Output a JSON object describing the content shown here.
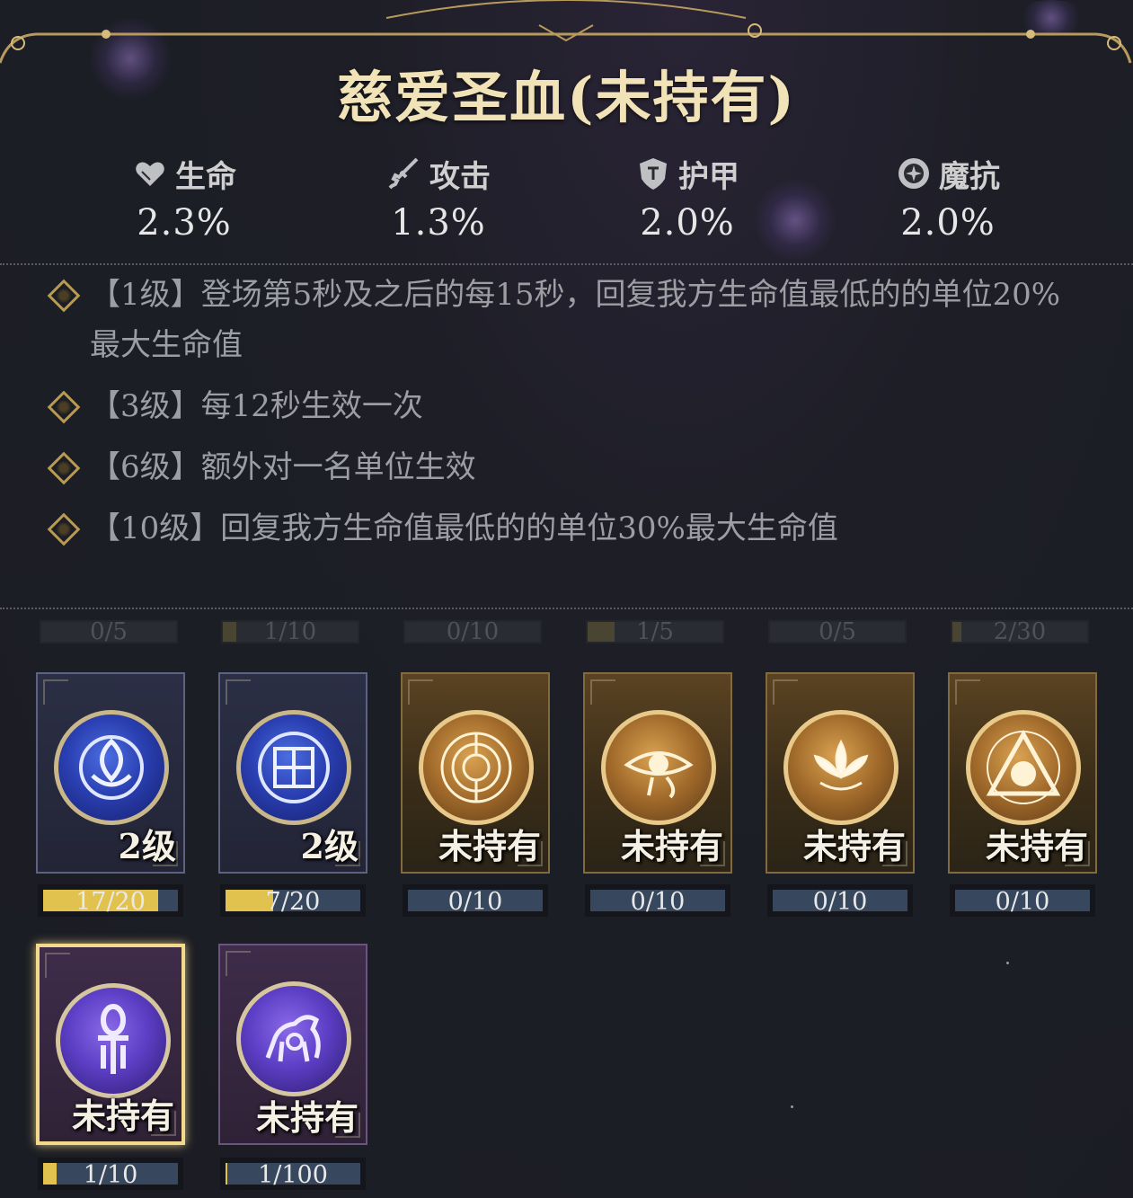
{
  "title": "慈爱圣血(未持有)",
  "stats": [
    {
      "icon": "heart-icon",
      "label": "生命",
      "value": "2.3%"
    },
    {
      "icon": "sword-icon",
      "label": "攻击",
      "value": "1.3%"
    },
    {
      "icon": "shield-icon",
      "label": "护甲",
      "value": "2.0%"
    },
    {
      "icon": "magic-orb-icon",
      "label": "魔抗",
      "value": "2.0%"
    }
  ],
  "effects": [
    {
      "text": "【1级】登场第5秒及之后的每15秒，回复我方生命值最低的的单位20%最大生命值"
    },
    {
      "text": "【3级】每12秒生效一次"
    },
    {
      "text": "【6级】额外对一名单位生效"
    },
    {
      "text": "【10级】回复我方生命值最低的的单位30%最大生命值"
    }
  ],
  "top_tracks": [
    {
      "text": "0/5",
      "fill": 0
    },
    {
      "text": "1/10",
      "fill": 0.1
    },
    {
      "text": "0/10",
      "fill": 0
    },
    {
      "text": "1/5",
      "fill": 0.2
    },
    {
      "text": "0/5",
      "fill": 0
    },
    {
      "text": "2/30",
      "fill": 0.067
    }
  ],
  "cards": [
    {
      "label": "2级",
      "progress": "17/20",
      "fill": 0.85,
      "theme": "blue",
      "emblem": "triquetra-moon-emblem"
    },
    {
      "label": "2级",
      "progress": "7/20",
      "fill": 0.35,
      "theme": "blue",
      "emblem": "longevity-symbol-emblem"
    },
    {
      "label": "未持有",
      "progress": "0/10",
      "fill": 0,
      "theme": "gold",
      "emblem": "maze-wheel-emblem"
    },
    {
      "label": "未持有",
      "progress": "0/10",
      "fill": 0,
      "theme": "gold",
      "emblem": "eye-of-horus-emblem"
    },
    {
      "label": "未持有",
      "progress": "0/10",
      "fill": 0,
      "theme": "gold",
      "emblem": "lotus-emblem"
    },
    {
      "label": "未持有",
      "progress": "0/10",
      "fill": 0,
      "theme": "gold",
      "emblem": "triangle-circle-emblem"
    },
    {
      "label": "未持有",
      "progress": "1/10",
      "fill": 0.1,
      "theme": "purple",
      "emblem": "ankh-emblem",
      "selected": true
    },
    {
      "label": "未持有",
      "progress": "1/100",
      "fill": 0.01,
      "theme": "purple",
      "emblem": "horse-emblem"
    }
  ]
}
